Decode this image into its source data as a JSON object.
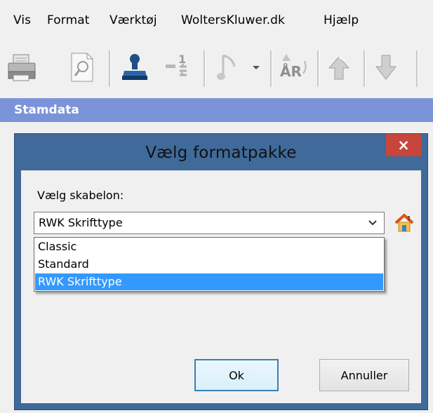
{
  "menu": {
    "items": [
      "Vis",
      "Format",
      "Værktøj",
      "WoltersKluwer.dk",
      "Hjælp"
    ]
  },
  "toolbar": {
    "icons": [
      "print-icon",
      "print-preview-icon",
      "stamp-icon",
      "numbering-icon",
      "note-icon",
      "dropdown-arrow-icon",
      "replace-text-icon",
      "arrow-up-icon",
      "arrow-down-icon"
    ]
  },
  "section": {
    "title": "Stamdata"
  },
  "dialog": {
    "title": "Vælg formatpakke",
    "close_label": "×",
    "template_label": "Vælg skabelon:",
    "selected_template": "RWK Skrifttype",
    "options": [
      "Classic",
      "Standard",
      "RWK Skrifttype"
    ],
    "ok_label": "Ok",
    "cancel_label": "Annuller"
  },
  "colors": {
    "section_bar": "#7b93d8",
    "dialog_frame": "#3f6a9a",
    "close_button": "#c7463c",
    "selection": "#3399ff"
  }
}
